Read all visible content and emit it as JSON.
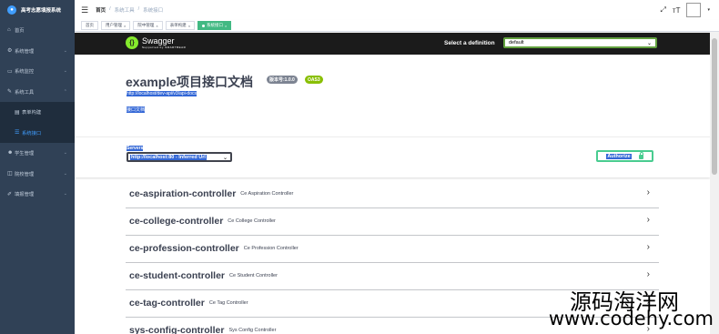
{
  "app": {
    "title": "高考志愿填报系统"
  },
  "sidebar": {
    "items": [
      {
        "label": "首页",
        "icon": "dashboard-icon",
        "glyph": "⌂",
        "chevron": false
      },
      {
        "label": "系统管理",
        "icon": "gear-icon",
        "glyph": "⚙",
        "chevron": true
      },
      {
        "label": "系统监控",
        "icon": "monitor-icon",
        "glyph": "▭",
        "chevron": true
      },
      {
        "label": "系统工具",
        "icon": "tool-icon",
        "glyph": "✎",
        "chevron": true,
        "expanded": true
      },
      {
        "label": "表单构建",
        "icon": "form-icon",
        "glyph": "▤",
        "sub": true
      },
      {
        "label": "系统接口",
        "icon": "swagger-icon",
        "glyph": "☰",
        "sub": true,
        "active": true
      },
      {
        "label": "学生管理",
        "icon": "user-icon",
        "glyph": "☻",
        "chevron": true
      },
      {
        "label": "院校管理",
        "icon": "school-icon",
        "glyph": "◫",
        "chevron": true
      },
      {
        "label": "填报管理",
        "icon": "edit-icon",
        "glyph": "✐",
        "chevron": true
      }
    ]
  },
  "breadcrumb": [
    "首页",
    "系统工具",
    "系统接口"
  ],
  "tags": [
    {
      "label": "首页",
      "active": false,
      "closable": false
    },
    {
      "label": "用户管理",
      "active": false,
      "closable": true
    },
    {
      "label": "院中管理",
      "active": false,
      "closable": true
    },
    {
      "label": "表单构建",
      "active": false,
      "closable": true
    },
    {
      "label": "系统接口",
      "active": true,
      "closable": true
    }
  ],
  "swagger": {
    "brand": "Swagger",
    "brand_sub": "Supported by SMARTBEAR",
    "definition_label": "Select a definition",
    "definition_value": "default",
    "title": "example项目接口文档",
    "version_badge": "版本号:1.0.0",
    "oas_badge": "OAS3",
    "url": "http://localhost/dev-api/v3/api-docs",
    "description": "接口文档",
    "servers_label": "Servers",
    "server_value": "http://localhost:80 - Inferred Url",
    "authorize_label": "Authorize",
    "controllers": [
      {
        "name": "ce-aspiration-controller",
        "desc": "Ce Aspiration Controller"
      },
      {
        "name": "ce-college-controller",
        "desc": "Ce College Controller"
      },
      {
        "name": "ce-profession-controller",
        "desc": "Ce Profession Controller"
      },
      {
        "name": "ce-student-controller",
        "desc": "Ce Student Controller"
      },
      {
        "name": "ce-tag-controller",
        "desc": "Ce Tag Controller"
      },
      {
        "name": "sys-config-controller",
        "desc": "Sys Config Controller"
      }
    ]
  },
  "watermark": {
    "line1": "源码海洋网",
    "line2": "www.codehy.com"
  },
  "colors": {
    "sidebar_bg": "#304156",
    "active_tag": "#42b983",
    "swagger_green": "#85ea2d",
    "authorize_green": "#49cc90",
    "selection": "#3367d6"
  }
}
